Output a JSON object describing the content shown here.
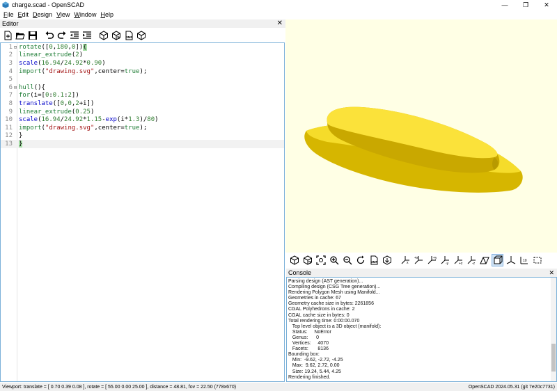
{
  "window": {
    "title": "charge.scad - OpenSCAD",
    "minimize": "—",
    "maximize": "❐",
    "close": "✕"
  },
  "menu": [
    "File",
    "Edit",
    "Design",
    "View",
    "Window",
    "Help"
  ],
  "editor": {
    "panel_title": "Editor",
    "close_glyph": "✕",
    "toolbar_icons": [
      "new-file-icon",
      "open-file-icon",
      "save-icon",
      "undo-icon",
      "redo-icon",
      "unindent-icon",
      "indent-icon",
      "preview-icon",
      "render-icon",
      "export-3mf-icon",
      "send-to-print-icon"
    ],
    "lines": [
      {
        "n": "1",
        "fold": "⊟",
        "text": "rotate([0,180,0]){"
      },
      {
        "n": "2",
        "fold": "",
        "text": "linear_extrude(2)"
      },
      {
        "n": "3",
        "fold": "",
        "text": "scale(16.94/24.92*0.90)"
      },
      {
        "n": "4",
        "fold": "",
        "text": "import(\"drawing.svg\",center=true);"
      },
      {
        "n": "5",
        "fold": "",
        "text": ""
      },
      {
        "n": "6",
        "fold": "⊟",
        "text": "hull(){"
      },
      {
        "n": "7",
        "fold": "",
        "text": "for(i=[0:0.1:2])"
      },
      {
        "n": "8",
        "fold": "",
        "text": "translate([0,0,2+i])"
      },
      {
        "n": "9",
        "fold": "",
        "text": "linear_extrude(0.25)"
      },
      {
        "n": "10",
        "fold": "",
        "text": "scale(16.94/24.92*1.15-exp(i*1.3)/80)"
      },
      {
        "n": "11",
        "fold": "",
        "text": "import(\"drawing.svg\",center=true);"
      },
      {
        "n": "12",
        "fold": "",
        "text": "}"
      },
      {
        "n": "13",
        "fold": "",
        "text": "}"
      }
    ]
  },
  "viewport": {
    "background": "#ffffe5",
    "model_color": "#f8de1c",
    "toolbar_icons": [
      "preview-icon",
      "render-icon",
      "view-all-icon",
      "zoom-in-icon",
      "zoom-out-icon",
      "reset-view-icon",
      "export-3mf-icon",
      "send-to-print-icon",
      "view-right-icon",
      "view-top-icon",
      "view-bottom-icon",
      "view-left-icon",
      "view-front-icon",
      "view-back-icon",
      "perspective-icon",
      "orthogonal-icon",
      "show-axes-icon",
      "show-scale-markers-icon",
      "show-edges-icon"
    ]
  },
  "console": {
    "panel_title": "Console",
    "close_glyph": "✕",
    "lines": [
      "Parsing design (AST generation)...",
      "Compiling design (CSG Tree generation)...",
      "Rendering Polygon Mesh using Manifold...",
      "Geometries in cache: 67",
      "Geometry cache size in bytes: 2261856",
      "CGAL Polyhedrons in cache: 2",
      "CGAL cache size in bytes: 0",
      "Total rendering time: 0:00:00.070",
      "   Top level object is a 3D object (manifold):",
      "   Status:     NoError",
      "   Genus:      0",
      "   Vertices:     4070",
      "   Facets:       8136",
      "Bounding box:",
      "   Min:  -9.62, -2.72, -4.25",
      "   Max:  9.62, 2.72, 0.00",
      "   Size: 19.24, 5.44, 4.25",
      "Rendering finished."
    ]
  },
  "status": {
    "viewport": "Viewport: translate = [ 0.70 0.39 0.08 ], rotate = [ 55.00 0.00 25.00 ], distance = 48.81, fov = 22.50 (778x670)",
    "version": "OpenSCAD 2024.05.31 (git 7e20c7731)"
  }
}
